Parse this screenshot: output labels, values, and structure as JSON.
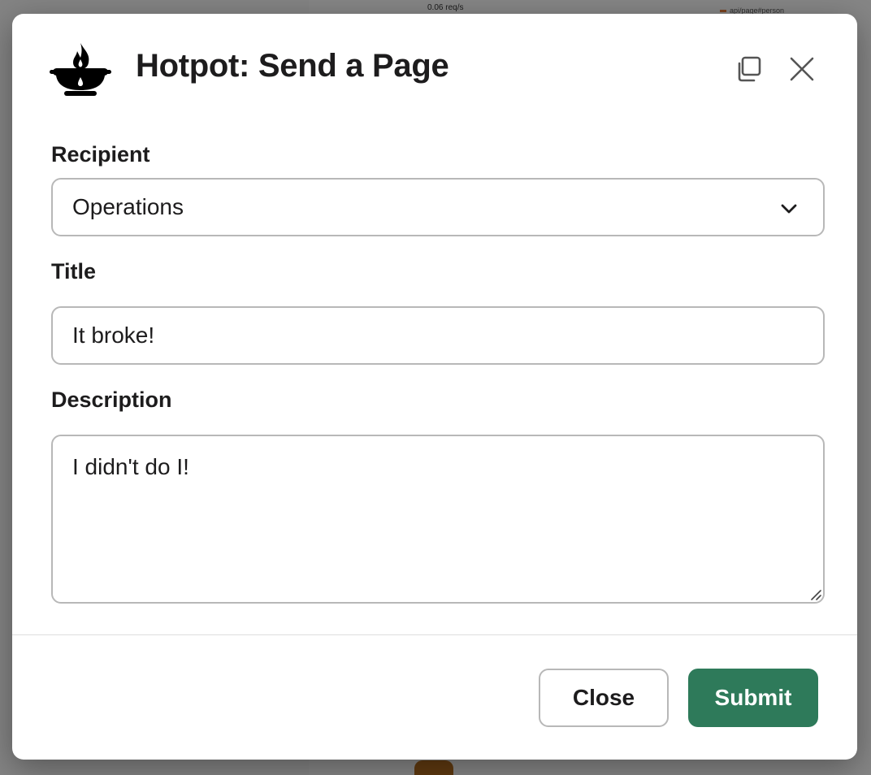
{
  "background": {
    "chart_rate_label": "0.06 req/s",
    "legend_label": "api/page#person"
  },
  "modal": {
    "title": "Hotpot: Send a Page",
    "logo_icon": "hotpot-icon",
    "copy_icon": "copy-icon",
    "close_icon": "close-icon"
  },
  "form": {
    "recipient": {
      "label": "Recipient",
      "selected": "Operations"
    },
    "title": {
      "label": "Title",
      "value": "It broke!"
    },
    "description": {
      "label": "Description",
      "value": "I didn't do I!"
    }
  },
  "footer": {
    "close_label": "Close",
    "submit_label": "Submit"
  },
  "colors": {
    "submit_bg": "#2e7a5a",
    "border": "#b8b8b8",
    "text": "#1d1c1d"
  }
}
